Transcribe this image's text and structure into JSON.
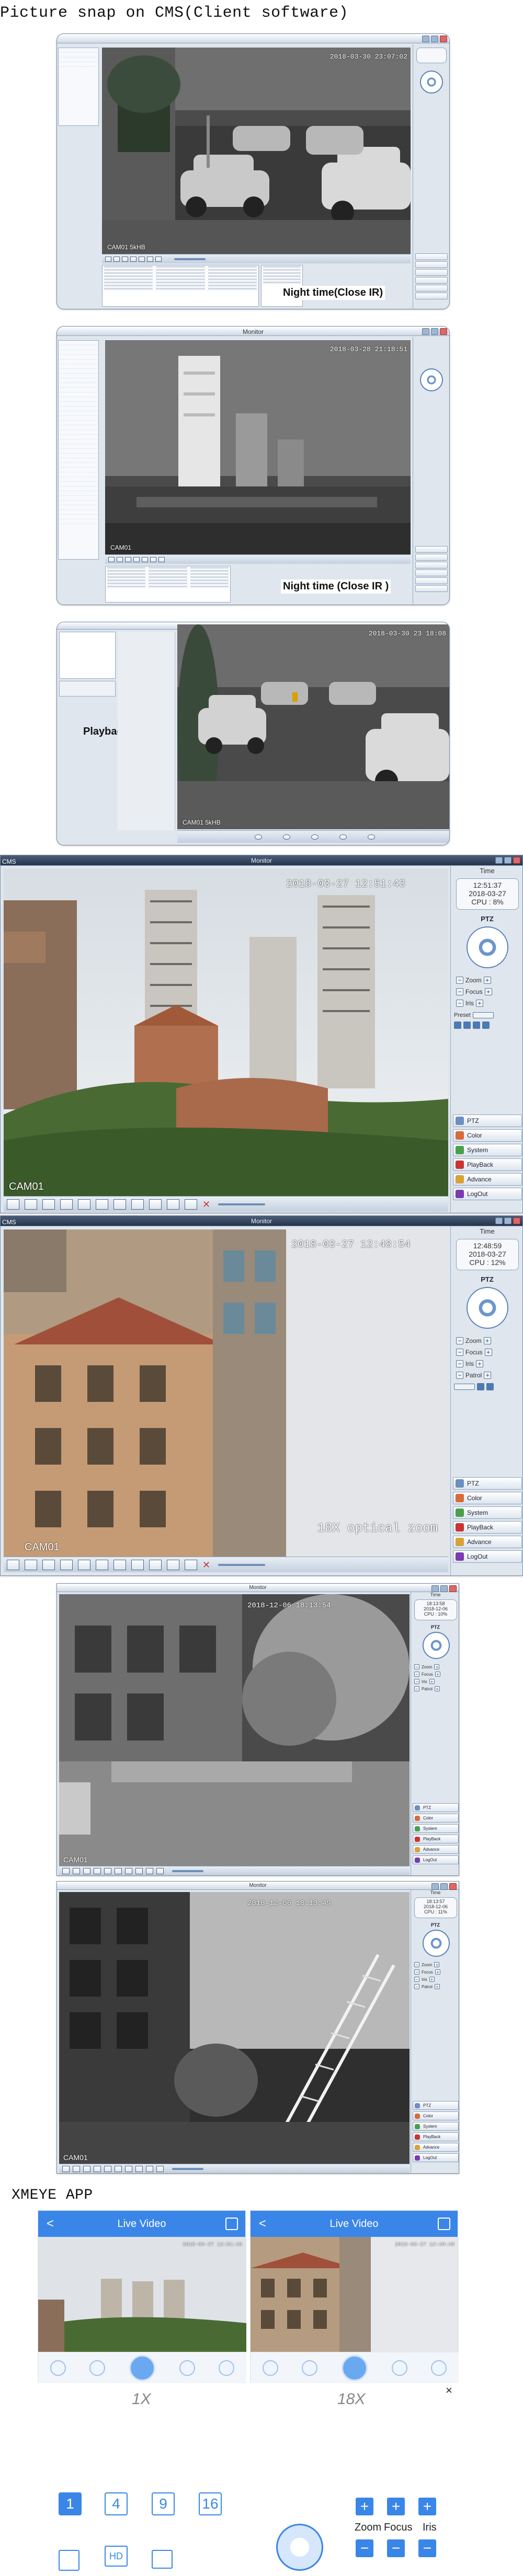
{
  "section_cms": "Picture snap on CMS(Client software)",
  "section_app": "XMEYE APP",
  "snap1": {
    "title": "",
    "timestamp": "2018-03-30 23:07:02",
    "cam": "CAM01 5kHB",
    "caption": "Night time(Close IR)"
  },
  "snap2": {
    "title": "Monitor",
    "timestamp": "2018-03-28 21:18:51",
    "cam": "CAM01",
    "caption": "Night time (Close IR )"
  },
  "snap3": {
    "timestamp": "2018-03-30 23 18:08",
    "cam": "CAM01 5kHB",
    "caption": "Playback"
  },
  "mon1": {
    "app": "CMS",
    "title": "Monitor",
    "time_header": "Time",
    "clock_time": "12:51:37",
    "clock_date": "2018-03-27",
    "cpu": "CPU : 8%",
    "timestamp": "2018-03-27 12:51:43",
    "cam": "CAM01",
    "ptz_label": "PTZ",
    "ctrl": [
      "Zoom",
      "Focus",
      "Iris"
    ],
    "preset": "Preset",
    "menu": [
      "PTZ",
      "Color",
      "System",
      "PlayBack",
      "Advance",
      "LogOut"
    ]
  },
  "mon2": {
    "app": "CMS",
    "title": "Monitor",
    "time_header": "Time",
    "clock_time": "12:48:59",
    "clock_date": "2018-03-27",
    "cpu": "CPU : 12%",
    "timestamp": "2018-03-27 12:48:54",
    "cam": "CAM01",
    "zoom_note": "18X optical zoom",
    "ptz_label": "PTZ",
    "ctrl": [
      "Zoom",
      "Focus",
      "Iris",
      "Patrol"
    ],
    "menu": [
      "PTZ",
      "Color",
      "System",
      "PlayBack",
      "Advance",
      "LogOut"
    ]
  },
  "mon3": {
    "title": "Monitor",
    "time_header": "Time",
    "clock_time": "18:13:58",
    "clock_date": "2018-12-06",
    "cpu": "CPU : 10%",
    "timestamp": "2018-12-06 18:13:54",
    "cam": "CAM01",
    "ptz_label": "PTZ",
    "ctrl": [
      "Zoom",
      "Focus",
      "Iris",
      "Patrol"
    ],
    "menu": [
      "PTZ",
      "Color",
      "System",
      "PlayBack",
      "Advance",
      "LogOut"
    ]
  },
  "mon4": {
    "title": "Monitor",
    "time_header": "Time",
    "clock_time": "18:13:57",
    "clock_date": "2018-12-06",
    "cpu": "CPU : 11%",
    "timestamp": "2018-12-06 18:13:49",
    "cam": "CAM01",
    "ptz_label": "PTZ",
    "ctrl": [
      "Zoom",
      "Focus",
      "Iris",
      "Patrol"
    ],
    "menu": [
      "PTZ",
      "Color",
      "System",
      "PlayBack",
      "Advance",
      "LogOut"
    ]
  },
  "app": {
    "left": {
      "title": "Live Video",
      "back": "<",
      "timestamp": "2018-03-27 12:51:46",
      "zoom": "1X"
    },
    "right": {
      "title": "Live Video",
      "back": "<",
      "timestamp": "2018-03-27 12:49:49",
      "zoom": "18X"
    },
    "close": "×",
    "splits": [
      "1",
      "4",
      "9",
      "16"
    ],
    "zoom": "Zoom",
    "focus": "Focus",
    "iris": "Iris",
    "plus": "+",
    "minus": "−",
    "hd": "HD"
  },
  "colors": {
    "accent": "#3a86e8",
    "win_bg": "#dfe6ee",
    "night_gray": "#6a6a6a"
  }
}
